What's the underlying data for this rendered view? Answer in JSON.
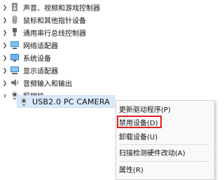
{
  "tree": {
    "items": [
      {
        "label": "声音、视频和游戏控制器",
        "icon": "speaker-icon",
        "expanded": false
      },
      {
        "label": "鼠标和其他指针设备",
        "icon": "mouse-icon",
        "expanded": false
      },
      {
        "label": "通用串行总线控制器",
        "icon": "usb-icon",
        "expanded": false
      },
      {
        "label": "网络适配器",
        "icon": "network-adapter-icon",
        "expanded": false
      },
      {
        "label": "系统设备",
        "icon": "system-device-icon",
        "expanded": false
      },
      {
        "label": "显示适配器",
        "icon": "display-adapter-icon",
        "expanded": false
      },
      {
        "label": "音频输入和输出",
        "icon": "audio-io-icon",
        "expanded": false
      },
      {
        "label": "照相机",
        "icon": "camera-icon",
        "expanded": true
      }
    ],
    "camera_child": {
      "label": "USB2.0 PC CAMERA",
      "icon": "webcam-icon",
      "selected": true
    }
  },
  "context_menu": {
    "items": [
      {
        "label": "更新驱动程序(P)"
      },
      {
        "label": "禁用设备(D)",
        "highlighted": true
      },
      {
        "label": "卸载设备(U)"
      },
      {
        "label": "扫描检测硬件改动(A)"
      },
      {
        "label": "属性(R)"
      }
    ],
    "highlight_color": "#e02020"
  }
}
